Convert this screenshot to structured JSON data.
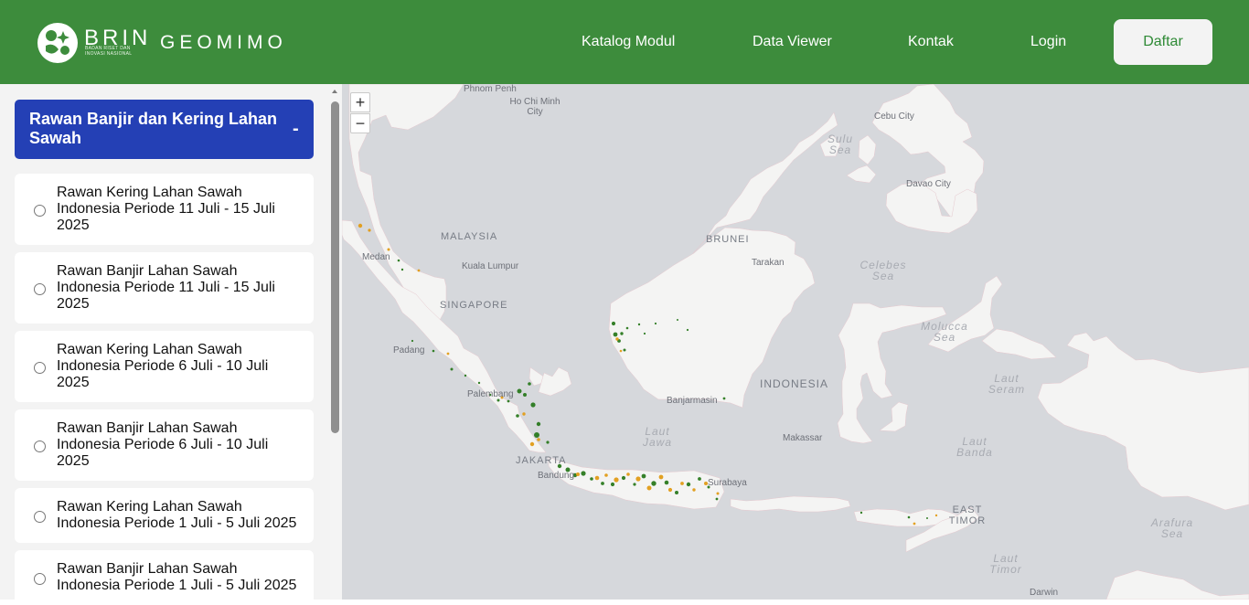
{
  "header": {
    "brand": "BRIN",
    "brand_subtitle": "BADAN RISET DAN INOVASI NASIONAL",
    "app_name": "GEOMIMO",
    "nav": [
      {
        "label": "Katalog Modul"
      },
      {
        "label": "Data Viewer"
      },
      {
        "label": "Kontak"
      },
      {
        "label": "Login"
      }
    ],
    "register_label": "Daftar",
    "colors": {
      "header": "#3d8c3c",
      "group_header": "#2440b5"
    }
  },
  "sidebar": {
    "group": {
      "title": "Rawan Banjir dan Kering Lahan Sawah",
      "toggle": "-"
    },
    "items": [
      {
        "label": "Rawan Kering Lahan Sawah Indonesia Periode 11 Juli - 15 Juli 2025"
      },
      {
        "label": "Rawan Banjir Lahan Sawah Indonesia Periode 11 Juli - 15 Juli 2025"
      },
      {
        "label": "Rawan Kering Lahan Sawah Indonesia Periode 6 Juli - 10 Juli 2025"
      },
      {
        "label": "Rawan Banjir Lahan Sawah Indonesia Periode 6 Juli - 10 Juli 2025"
      },
      {
        "label": "Rawan Kering Lahan Sawah Indonesia Periode 1 Juli - 5 Juli 2025"
      },
      {
        "label": "Rawan Banjir Lahan Sawah Indonesia Periode 1 Juli - 5 Juli 2025"
      }
    ]
  },
  "map": {
    "zoom_in": "+",
    "zoom_out": "−",
    "labels": {
      "phnom_penh": "Phnom Penh",
      "ho_chi_minh": "Ho Chi Minh\nCity",
      "cebu": "Cebu City",
      "davao": "Davao City",
      "sulu": "Sulu\nSea",
      "medan": "Medan",
      "malaysia": "MALAYSIA",
      "kuala_lumpur": "Kuala Lumpur",
      "brunei": "BRUNEI",
      "tarakan": "Tarakan",
      "celebes": "Celebes\nSea",
      "singapore": "SINGAPORE",
      "padang": "Padang",
      "molucca": "Molucca\nSea",
      "palembang": "Palembang",
      "indonesia": "INDONESIA",
      "banjarmasin": "Banjarmasin",
      "laut_seram": "Laut\nSeram",
      "laut_jawa": "Laut\nJawa",
      "makassar": "Makassar",
      "jakarta": "JAKARTA",
      "bandung": "Bandung",
      "surabaya": "Surabaya",
      "laut_banda": "Laut\nBanda",
      "east_timor": "EAST\nTIMOR",
      "arafura": "Arafura\nSea",
      "laut_timor": "Laut\nTimor",
      "darwin": "Darwin"
    }
  }
}
